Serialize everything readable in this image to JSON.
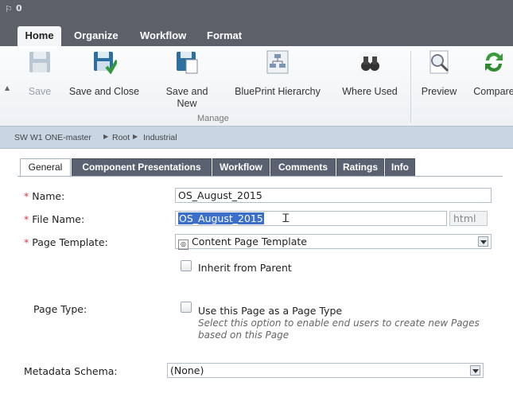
{
  "titlebar": {
    "count": "0"
  },
  "ribbon_tabs": [
    "Home",
    "Organize",
    "Workflow",
    "Format"
  ],
  "ribbon": {
    "save": "Save",
    "save_close": "Save and Close",
    "save_new_1": "Save and",
    "save_new_2": "New",
    "blueprint": "BluePrint Hierarchy",
    "where_used": "Where Used",
    "preview": "Preview",
    "compare": "Compare",
    "group_label": "Manage"
  },
  "breadcrumb": [
    "SW W1 ONE-master",
    "Root",
    "Industrial"
  ],
  "page_tabs": [
    "General",
    "Component Presentations",
    "Workflow",
    "Comments",
    "Ratings",
    "Info"
  ],
  "form": {
    "name_label": "Name:",
    "name_value": "OS_August_2015",
    "filename_label": "File Name:",
    "filename_value": "OS_August_2015",
    "filename_ext": "html",
    "template_label": "Page Template:",
    "template_value": "Content Page Template",
    "inherit_label": "Inherit from Parent",
    "pagetype_label": "Page Type:",
    "pagetype_option": "Use this Page as a Page Type",
    "pagetype_hint_1": "Select this option to enable end users to create new Pages",
    "pagetype_hint_2": "based on this Page",
    "metadata_label": "Metadata Schema:",
    "metadata_value": "(None)",
    "required_mark": "*"
  }
}
